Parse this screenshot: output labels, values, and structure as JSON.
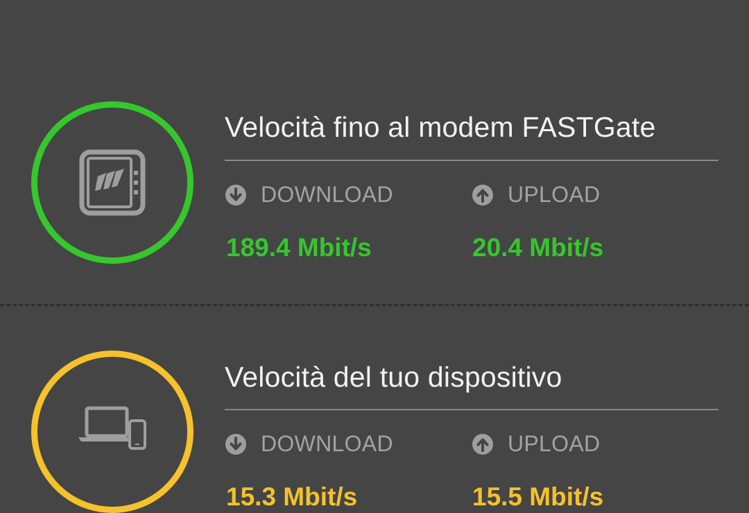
{
  "colors": {
    "background": "#454545",
    "good": "#35c72d",
    "warn": "#f5c22b",
    "icon_gray": "#9e9e9e",
    "text": "#f2f2f2",
    "label": "#a3a3a3"
  },
  "sections": [
    {
      "title": "Velocità fino al modem FASTGate",
      "icon": "modem-icon",
      "status": "good",
      "download_label": "DOWNLOAD",
      "upload_label": "UPLOAD",
      "download_value": "189.4 Mbit/s",
      "upload_value": "20.4 Mbit/s"
    },
    {
      "title": "Velocità del tuo dispositivo",
      "icon": "devices-icon",
      "status": "warn",
      "download_label": "DOWNLOAD",
      "upload_label": "UPLOAD",
      "download_value": "15.3 Mbit/s",
      "upload_value": "15.5 Mbit/s"
    }
  ]
}
